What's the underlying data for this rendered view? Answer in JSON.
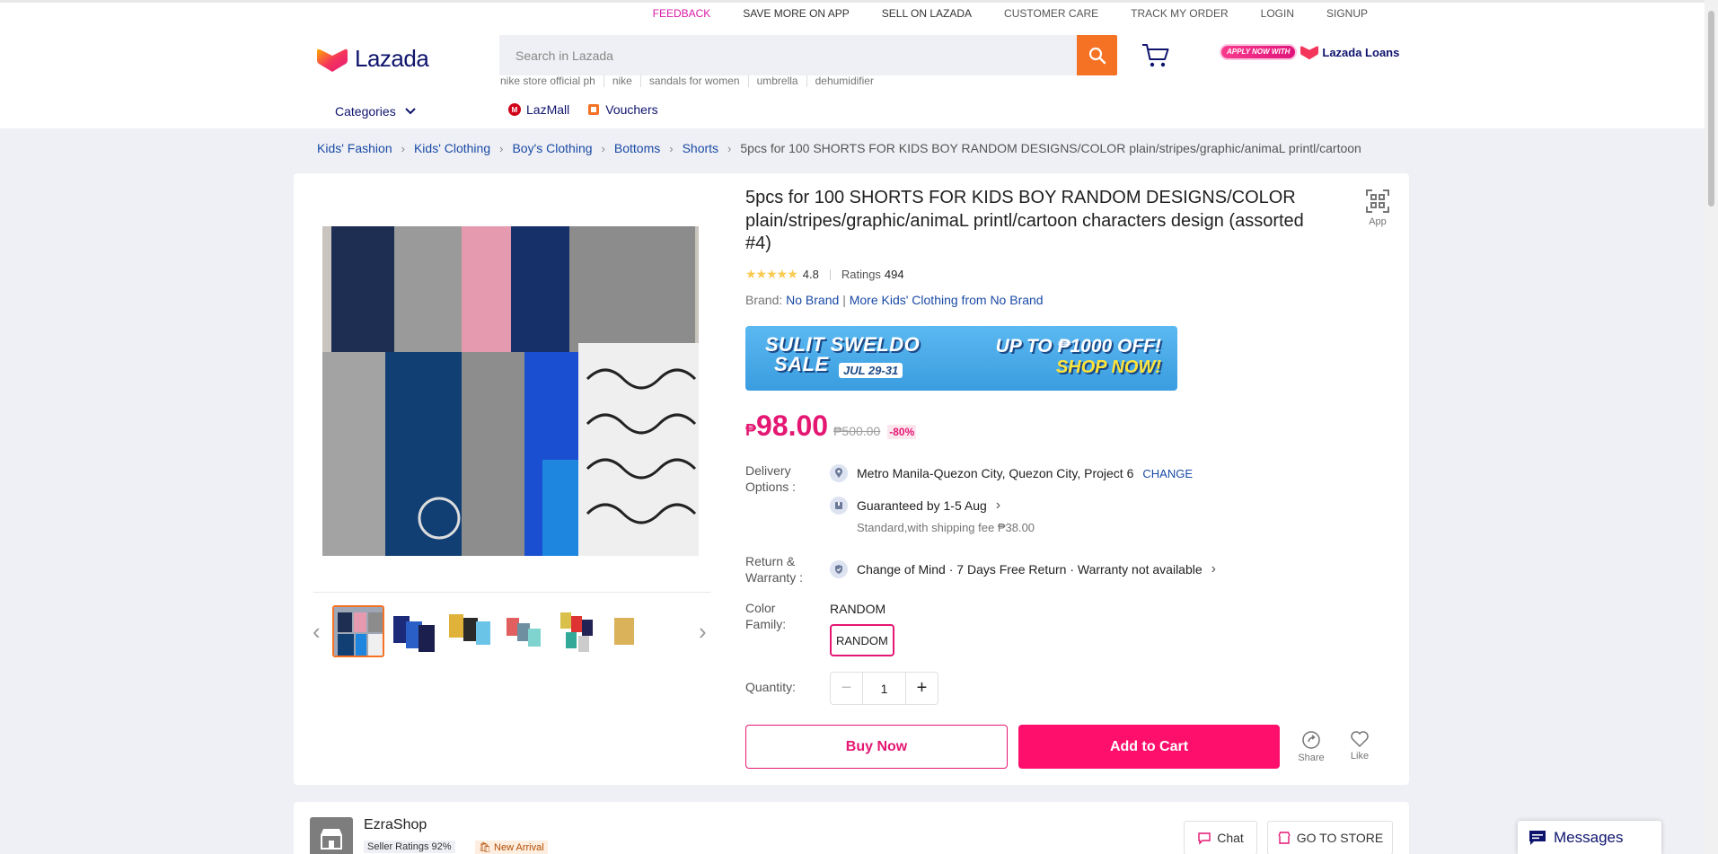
{
  "topbar": {
    "feedback": "FEEDBACK",
    "save_app": "SAVE MORE ON APP",
    "sell": "SELL ON LAZADA",
    "care": "CUSTOMER CARE",
    "track": "TRACK MY ORDER",
    "login": "LOGIN",
    "signup": "SIGNUP"
  },
  "header": {
    "logo": "Lazada",
    "search_placeholder": "Search in Lazada",
    "suggestions": [
      "nike store official ph",
      "nike",
      "sandals for women",
      "umbrella",
      "dehumidifier"
    ],
    "apply_now": "APPLY NOW WITH",
    "loans": "Lazada Loans",
    "categories": "Categories",
    "lazmall": "LazMall",
    "vouchers": "Vouchers"
  },
  "breadcrumb": [
    "Kids' Fashion",
    "Kids' Clothing",
    "Boy's Clothing",
    "Bottoms",
    "Shorts"
  ],
  "breadcrumb_current": "5pcs for 100 SHORTS FOR KIDS BOY RANDOM DESIGNS/COLOR plain/stripes/graphic/animaL printl/cartoon",
  "product": {
    "title": "5pcs for 100 SHORTS FOR KIDS BOY RANDOM DESIGNS/COLOR plain/stripes/graphic/animaL printl/cartoon characters design (assorted #4)",
    "app_label": "App",
    "rating": "4.8",
    "rating_fraction": 0.96,
    "ratings_label": "Ratings",
    "ratings_count": "494",
    "brand_label": "Brand:",
    "brand": "No Brand",
    "more_from": "More Kids' Clothing from No Brand",
    "banner": {
      "line1": "SULIT SWELDO",
      "line2": "SALE",
      "dates": "JUL 29-31",
      "offer": "UP TO ₱1000 OFF!",
      "cta": "SHOP NOW!"
    },
    "currency": "₱",
    "price": "98.00",
    "original_price": "₱500.00",
    "discount": "-80%",
    "delivery_label": "Delivery Options :",
    "location": "Metro Manila-Quezon City, Quezon City, Project 6",
    "change": "CHANGE",
    "guaranteed": "Guaranteed by 1-5 Aug",
    "shipping": "Standard,with shipping fee ₱38.00",
    "return_label": "Return & Warranty :",
    "return_text": "Change of Mind · 7 Days Free Return · Warranty not available",
    "color_label": "Color Family:",
    "color_value": "RANDOM",
    "color_option": "RANDOM",
    "quantity_label": "Quantity:",
    "quantity": "1",
    "buy_now": "Buy Now",
    "add_to_cart": "Add to Cart",
    "share": "Share",
    "like": "Like"
  },
  "store": {
    "name": "EzraShop",
    "seller_ratings": "Seller Ratings 92%",
    "new_arrival": "New Arrival",
    "chat": "Chat",
    "go_to_store": "GO TO STORE"
  },
  "messages": "Messages",
  "colors": {
    "accent": "#f57224",
    "price": "#e41772",
    "cart": "#fe0f6c",
    "link": "#1a4aa5"
  }
}
